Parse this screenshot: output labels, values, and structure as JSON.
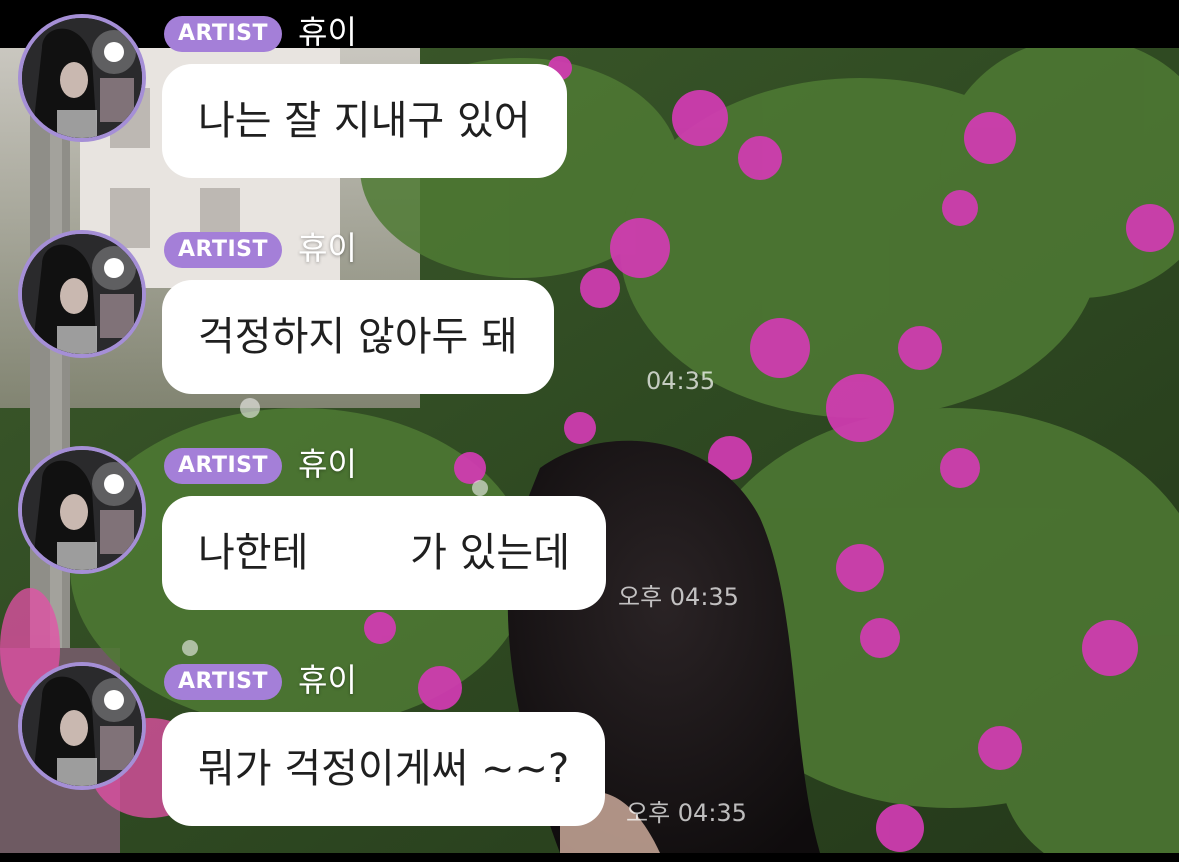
{
  "artist_badge": "ARTIST",
  "artist_name": "휴이",
  "messages": [
    {
      "text": "나는 잘 지내구 있어",
      "time": ""
    },
    {
      "text": "걱정하지 않아두 돼",
      "time": "04:35"
    },
    {
      "text": "나한테        가 있는데",
      "time": "오후 04:35"
    },
    {
      "text": "뭐가 걱정이게써 ~~?",
      "time": "오후 04:35"
    }
  ],
  "colors": {
    "badge": "#a47fd8",
    "avatar_ring": "#a58fd6",
    "bubble": "#ffffff",
    "top_bar": "#000000"
  }
}
